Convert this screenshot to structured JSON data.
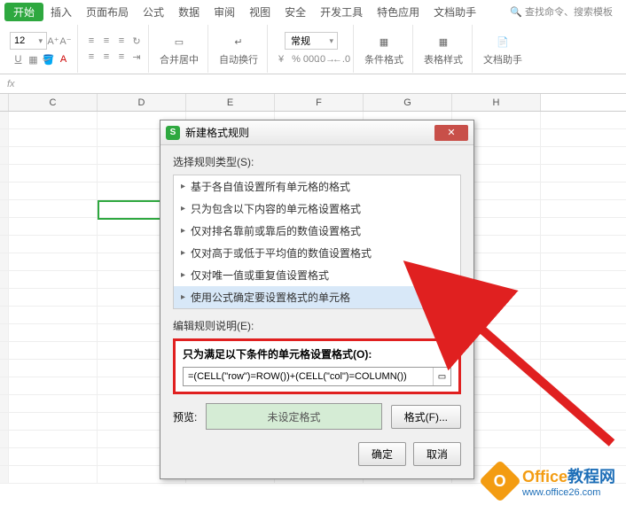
{
  "ribbon": {
    "tabs": [
      "开始",
      "插入",
      "页面布局",
      "公式",
      "数据",
      "审阅",
      "视图",
      "安全",
      "开发工具",
      "特色应用",
      "文档助手"
    ],
    "active_index": 0,
    "search_placeholder": "查找命令、搜索模板",
    "font_size": "12",
    "number_format": "常规",
    "merge_label": "合并居中",
    "wrap_label": "自动换行",
    "cond_fmt": "条件格式",
    "table_fmt": "表格样式",
    "doc_helper": "文档助手"
  },
  "fx_label": "fx",
  "columns": [
    "",
    "C",
    "D",
    "E",
    "F",
    "G",
    "H"
  ],
  "dialog": {
    "title": "新建格式规则",
    "select_label": "选择规则类型(S):",
    "rules": [
      "基于各自值设置所有单元格的格式",
      "只为包含以下内容的单元格设置格式",
      "仅对排名靠前或靠后的数值设置格式",
      "仅对高于或低于平均值的数值设置格式",
      "仅对唯一值或重复值设置格式",
      "使用公式确定要设置格式的单元格"
    ],
    "selected_rule_index": 5,
    "edit_label": "编辑规则说明(E):",
    "formula_label": "只为满足以下条件的单元格设置格式(O):",
    "formula_value": "=(CELL(\"row\")=ROW())+(CELL(\"col\")=COLUMN())",
    "preview_label": "预览:",
    "preview_text": "未设定格式",
    "format_btn": "格式(F)...",
    "ok": "确定",
    "cancel": "取消"
  },
  "watermark": {
    "brand1": "Office",
    "brand2": "教程网",
    "url": "www.office26.com"
  }
}
